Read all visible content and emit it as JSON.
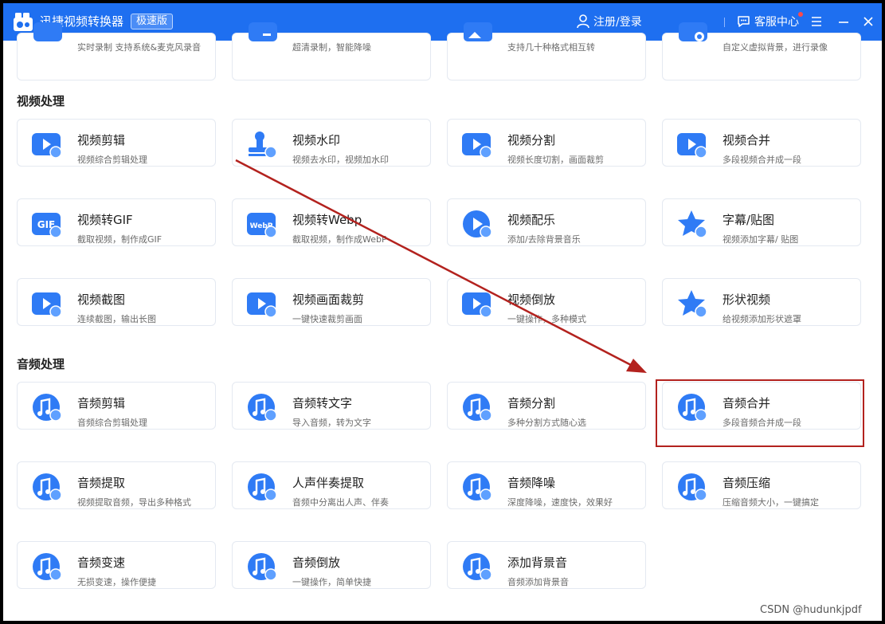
{
  "app": {
    "title": "迅捷视频转换器",
    "edition": "极速版",
    "login": "注册/登录",
    "support": "客服中心",
    "colors": {
      "titlebar": "#1e6ff0",
      "accent": "#2f7bf5",
      "highlight": "#b3221e"
    }
  },
  "top_row": [
    {
      "desc": "实时录制 支持系统&麦克风录音",
      "icon": "screen-record-icon"
    },
    {
      "desc": "超清录制，智能降噪",
      "icon": "camera-record-icon"
    },
    {
      "desc": "支持几十种格式相互转",
      "icon": "format-convert-icon"
    },
    {
      "desc": "自定义虚拟背景，进行录像",
      "icon": "virtual-background-icon"
    }
  ],
  "sections": {
    "video": {
      "title": "视频处理",
      "items": [
        {
          "name": "视频剪辑",
          "desc": "视频综合剪辑处理",
          "icon": "video-edit-icon"
        },
        {
          "name": "视频水印",
          "desc": "视频去水印，视频加水印",
          "icon": "video-watermark-icon"
        },
        {
          "name": "视频分割",
          "desc": "视频长度切割，画面裁剪",
          "icon": "video-split-icon"
        },
        {
          "name": "视频合并",
          "desc": "多段视频合并成一段",
          "icon": "video-merge-icon"
        },
        {
          "name": "视频转GIF",
          "desc": "截取视频，制作成GIF",
          "icon": "gif-icon",
          "badge": "GIF"
        },
        {
          "name": "视频转Webp",
          "desc": "截取视频，制作成WebP",
          "icon": "webp-icon",
          "badge": "WebP"
        },
        {
          "name": "视频配乐",
          "desc": "添加/去除背景音乐",
          "icon": "video-music-icon"
        },
        {
          "name": "字幕/贴图",
          "desc": "视频添加字幕/ 贴图",
          "icon": "subtitle-sticker-icon"
        },
        {
          "name": "视频截图",
          "desc": "连续截图，输出长图",
          "icon": "video-screenshot-icon"
        },
        {
          "name": "视频画面裁剪",
          "desc": "一键快速裁剪画面",
          "icon": "video-crop-icon"
        },
        {
          "name": "视频倒放",
          "desc": "一键操作，多种模式",
          "icon": "video-reverse-icon"
        },
        {
          "name": "形状视频",
          "desc": "给视频添加形状遮罩",
          "icon": "shape-video-icon"
        }
      ]
    },
    "audio": {
      "title": "音频处理",
      "items": [
        {
          "name": "音频剪辑",
          "desc": "音频综合剪辑处理",
          "icon": "audio-edit-icon"
        },
        {
          "name": "音频转文字",
          "desc": "导入音频，转为文字",
          "icon": "audio-to-text-icon"
        },
        {
          "name": "音频分割",
          "desc": "多种分割方式随心选",
          "icon": "audio-split-icon"
        },
        {
          "name": "音频合并",
          "desc": "多段音频合并成一段",
          "icon": "audio-merge-icon"
        },
        {
          "name": "音频提取",
          "desc": "视频提取音频，导出多种格式",
          "icon": "audio-extract-icon"
        },
        {
          "name": "人声伴奏提取",
          "desc": "音频中分离出人声、伴奏",
          "icon": "vocal-separate-icon"
        },
        {
          "name": "音频降噪",
          "desc": "深度降噪，速度快，效果好",
          "icon": "audio-denoise-icon"
        },
        {
          "name": "音频压缩",
          "desc": "压缩音频大小，一键搞定",
          "icon": "audio-compress-icon"
        },
        {
          "name": "音频变速",
          "desc": "无损变速，操作便捷",
          "icon": "audio-speed-icon"
        },
        {
          "name": "音频倒放",
          "desc": "一键操作，简单快捷",
          "icon": "audio-reverse-icon"
        },
        {
          "name": "添加背景音",
          "desc": "音频添加背景音",
          "icon": "add-background-sound-icon"
        }
      ]
    }
  },
  "watermark": "CSDN @hudunkjpdf"
}
